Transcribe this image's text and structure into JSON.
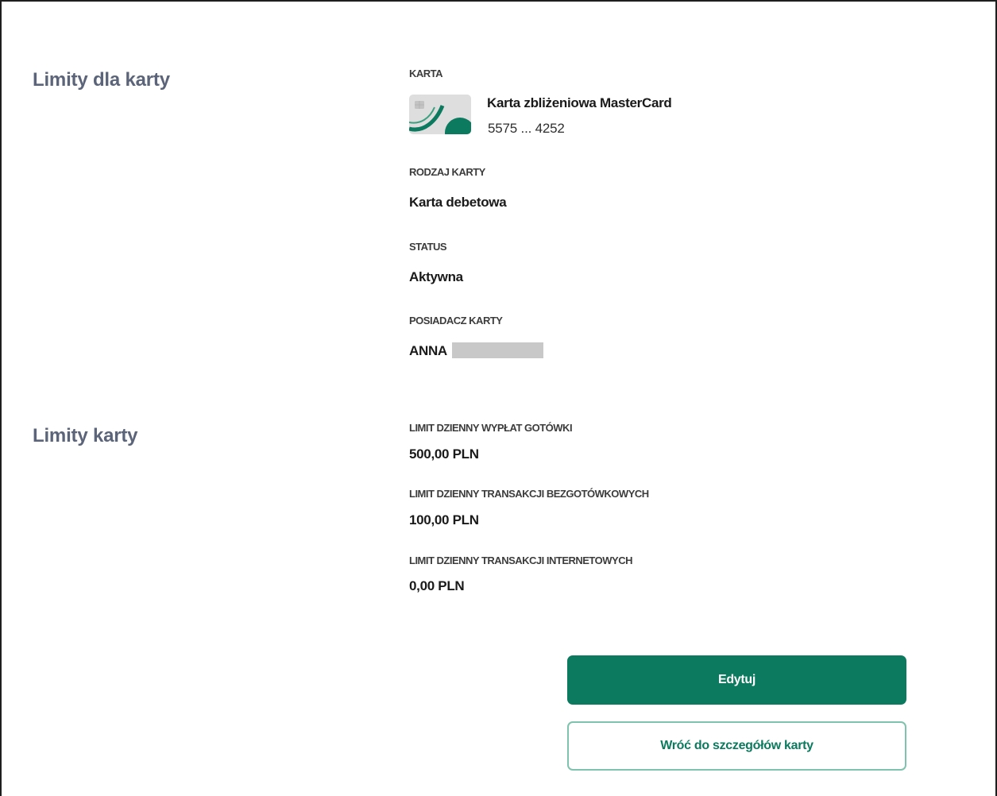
{
  "sections": {
    "card_limits_title": "Limity dla karty",
    "limits_title": "Limity karty"
  },
  "card": {
    "label": "KARTA",
    "name": "Karta zbliżeniowa MasterCard",
    "number": "5575 ... 4252",
    "thumb_icon": "credit-card-icon"
  },
  "card_type": {
    "label": "RODZAJ KARTY",
    "value": "Karta debetowa"
  },
  "status": {
    "label": "STATUS",
    "value": "Aktywna"
  },
  "holder": {
    "label": "POSIADACZ KARTY",
    "value": "ANNA"
  },
  "limits": [
    {
      "label": "LIMIT DZIENNY WYPŁAT GOTÓWKI",
      "value": "500,00 PLN"
    },
    {
      "label": "LIMIT DZIENNY TRANSAKCJI BEZGOTÓWKOWYCH",
      "value": "100,00 PLN"
    },
    {
      "label": "LIMIT DZIENNY TRANSAKCJI INTERNETOWYCH",
      "value": "0,00 PLN"
    }
  ],
  "actions": {
    "edit_label": "Edytuj",
    "back_label": "Wróć do szczegółów karty"
  },
  "colors": {
    "primary": "#0b7a5e",
    "secondary_border": "#7fc3ae",
    "section_title": "#5b6478"
  }
}
